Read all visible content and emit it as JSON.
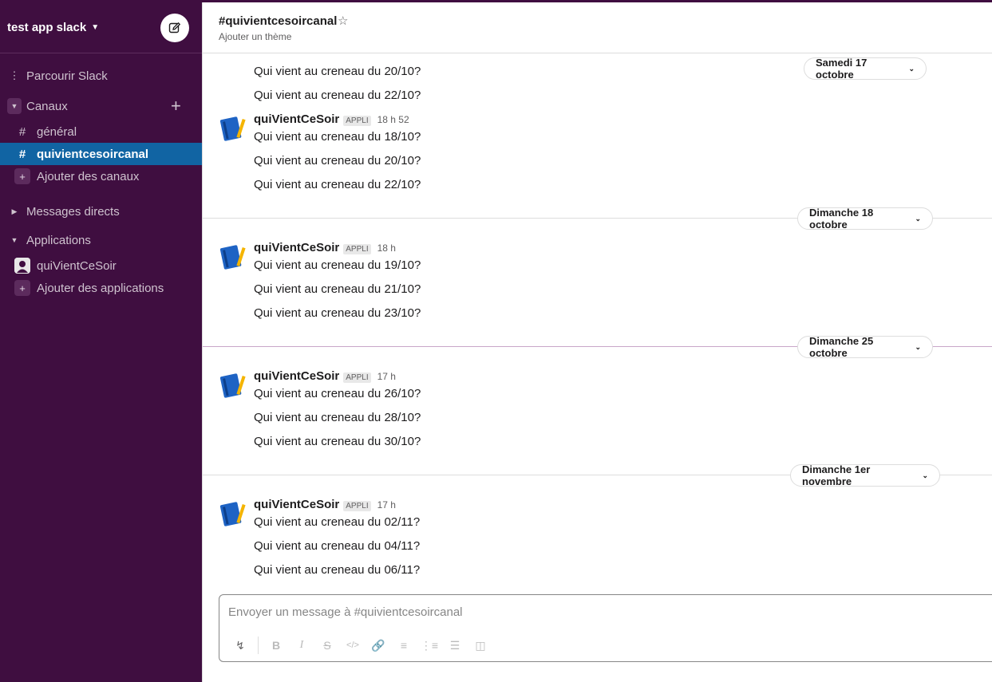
{
  "workspace": {
    "name": "test app slack",
    "caret_icon": "chevron-down-icon",
    "compose_icon": "compose-icon"
  },
  "sidebar": {
    "browse": "Parcourir Slack",
    "channels_header": "Canaux",
    "channels": [
      {
        "label": "général",
        "active": false
      },
      {
        "label": "quivientcesoircanal",
        "active": true
      }
    ],
    "add_channels": "Ajouter des canaux",
    "direct_messages_header": "Messages directs",
    "apps_header": "Applications",
    "apps": [
      {
        "label": "quiVientCeSoir"
      }
    ],
    "add_apps": "Ajouter des applications"
  },
  "channel": {
    "title": "#quivientcesoircanal",
    "topic": "Ajouter un thème"
  },
  "messages": {
    "top_lines": [
      "Qui vient au creneau du 20/10?",
      "Qui vient au creneau du 22/10?"
    ],
    "date_1": "Samedi 17 octobre",
    "group_1": {
      "sender": "quiVientCeSoir",
      "badge": "APPLI",
      "time": "18 h 52",
      "lines": [
        "Qui vient au creneau du 18/10?",
        "Qui vient au creneau du 20/10?",
        "Qui vient au creneau du 22/10?"
      ]
    },
    "date_2": "Dimanche 18 octobre",
    "group_2": {
      "sender": "quiVientCeSoir",
      "badge": "APPLI",
      "time": "18 h",
      "lines": [
        "Qui vient au creneau du 19/10?",
        "Qui vient au creneau du 21/10?",
        "Qui vient au creneau du 23/10?"
      ]
    },
    "date_3": "Dimanche 25 octobre",
    "group_3": {
      "sender": "quiVientCeSoir",
      "badge": "APPLI",
      "time": "17 h",
      "lines": [
        "Qui vient au creneau du 26/10?",
        "Qui vient au creneau du 28/10?",
        "Qui vient au creneau du 30/10?"
      ]
    },
    "date_4": "Dimanche 1er novembre",
    "group_4": {
      "sender": "quiVientCeSoir",
      "badge": "APPLI",
      "time": "17 h",
      "lines": [
        "Qui vient au creneau du 02/11?",
        "Qui vient au creneau du 04/11?",
        "Qui vient au creneau du 06/11?"
      ]
    }
  },
  "composer": {
    "placeholder": "Envoyer un message à #quivientcesoircanal",
    "toolbar_icons": [
      "shortcuts-bolt-icon",
      "bold-icon",
      "italic-icon",
      "strikethrough-icon",
      "code-icon",
      "link-icon",
      "ordered-list-icon",
      "bulleted-list-icon",
      "blockquote-icon",
      "code-block-icon"
    ]
  },
  "colors": {
    "sidebar_bg": "#3f0e40",
    "active_item": "#1164a3",
    "divider_new": "#c9a6c9"
  }
}
